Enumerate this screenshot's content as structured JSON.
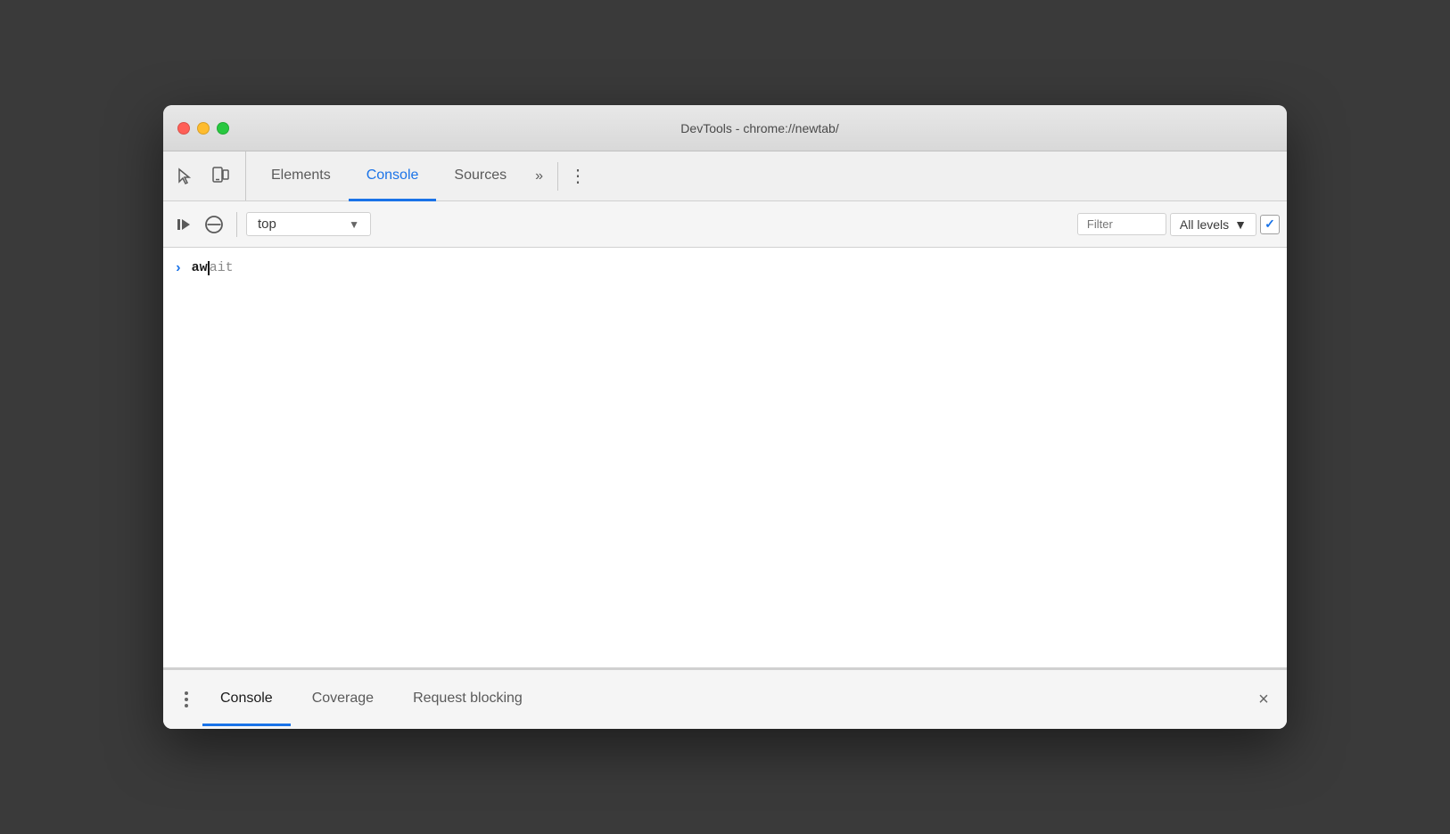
{
  "window": {
    "title": "DevTools - chrome://newtab/"
  },
  "titlebar": {
    "close": "close",
    "minimize": "minimize",
    "maximize": "maximize"
  },
  "main_tabs": {
    "items": [
      {
        "id": "elements",
        "label": "Elements",
        "active": false
      },
      {
        "id": "console",
        "label": "Console",
        "active": true
      },
      {
        "id": "sources",
        "label": "Sources",
        "active": false
      }
    ],
    "more_label": "»",
    "menu_label": "⋮"
  },
  "console_toolbar": {
    "context_label": "top",
    "filter_placeholder": "Filter",
    "levels_label": "All levels",
    "checkbox_char": "✓"
  },
  "console_content": {
    "entries": [
      {
        "prompt": ">",
        "text_typed": "aw",
        "text_autocomplete": "ait"
      }
    ]
  },
  "bottom_panel": {
    "tabs": [
      {
        "id": "console",
        "label": "Console",
        "active": true
      },
      {
        "id": "coverage",
        "label": "Coverage",
        "active": false
      },
      {
        "id": "request-blocking",
        "label": "Request blocking",
        "active": false
      }
    ],
    "close_label": "×"
  },
  "icons": {
    "cursor": "⬆",
    "device": "📱",
    "play_pause": "play-pause",
    "no_entry": "🚫",
    "dropdown_arrow": "▼",
    "chevron_right": "»"
  }
}
